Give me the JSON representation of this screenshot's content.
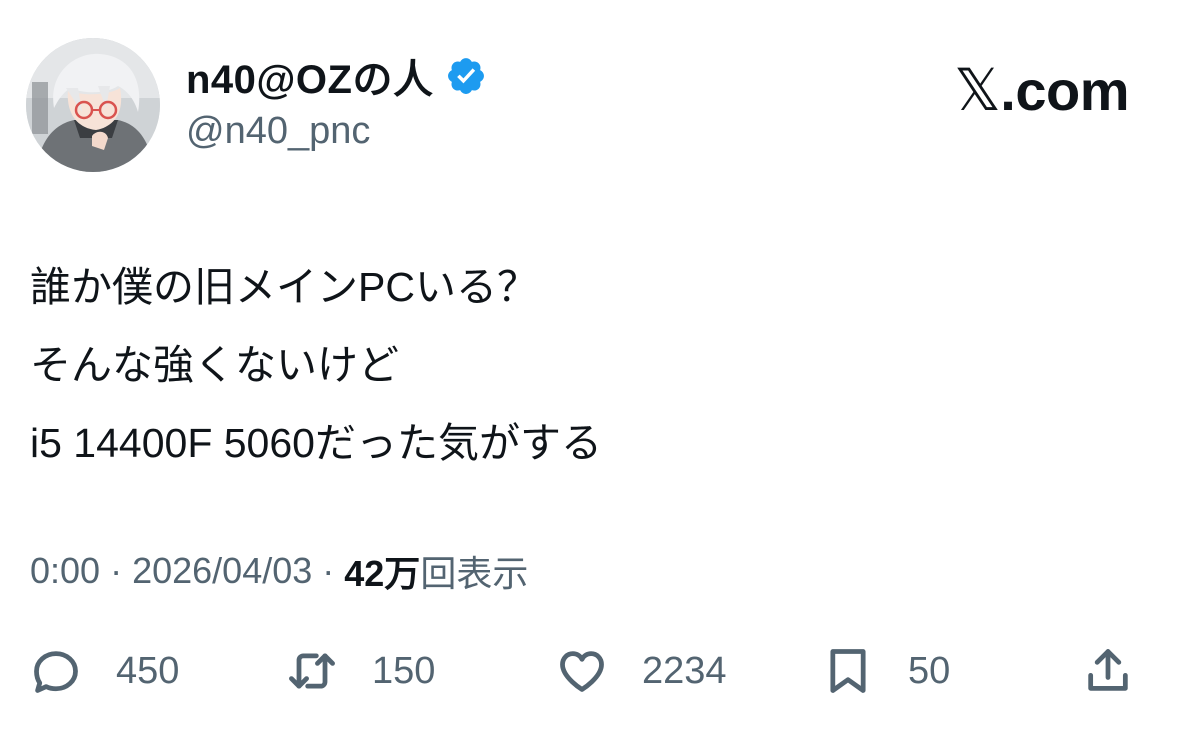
{
  "author": {
    "display_name": "n40@OZの人",
    "handle": "@n40_pnc",
    "verified": true,
    "verified_color": "#1d9bf0"
  },
  "brand": {
    "glyph": "𝕏",
    "suffix": ".com"
  },
  "tweet": {
    "lines": [
      "誰か僕の旧メインPCいる？",
      "そんな強くないけど",
      "i5 14400F 5060だった気がする"
    ]
  },
  "meta": {
    "time": "0:00",
    "separator": "·",
    "date": "2026/04/03",
    "views_count": "42万",
    "views_label": "回表示"
  },
  "actions": {
    "reply": {
      "icon": "reply-bubble-icon",
      "count": "450"
    },
    "retweet": {
      "icon": "retweet-icon",
      "count": "150"
    },
    "like": {
      "icon": "heart-icon",
      "count": "2234"
    },
    "bookmark": {
      "icon": "bookmark-icon",
      "count": "50"
    },
    "share": {
      "icon": "share-upload-icon"
    }
  },
  "colors": {
    "text": "#0f1419",
    "secondary": "#536471",
    "background": "#ffffff"
  }
}
